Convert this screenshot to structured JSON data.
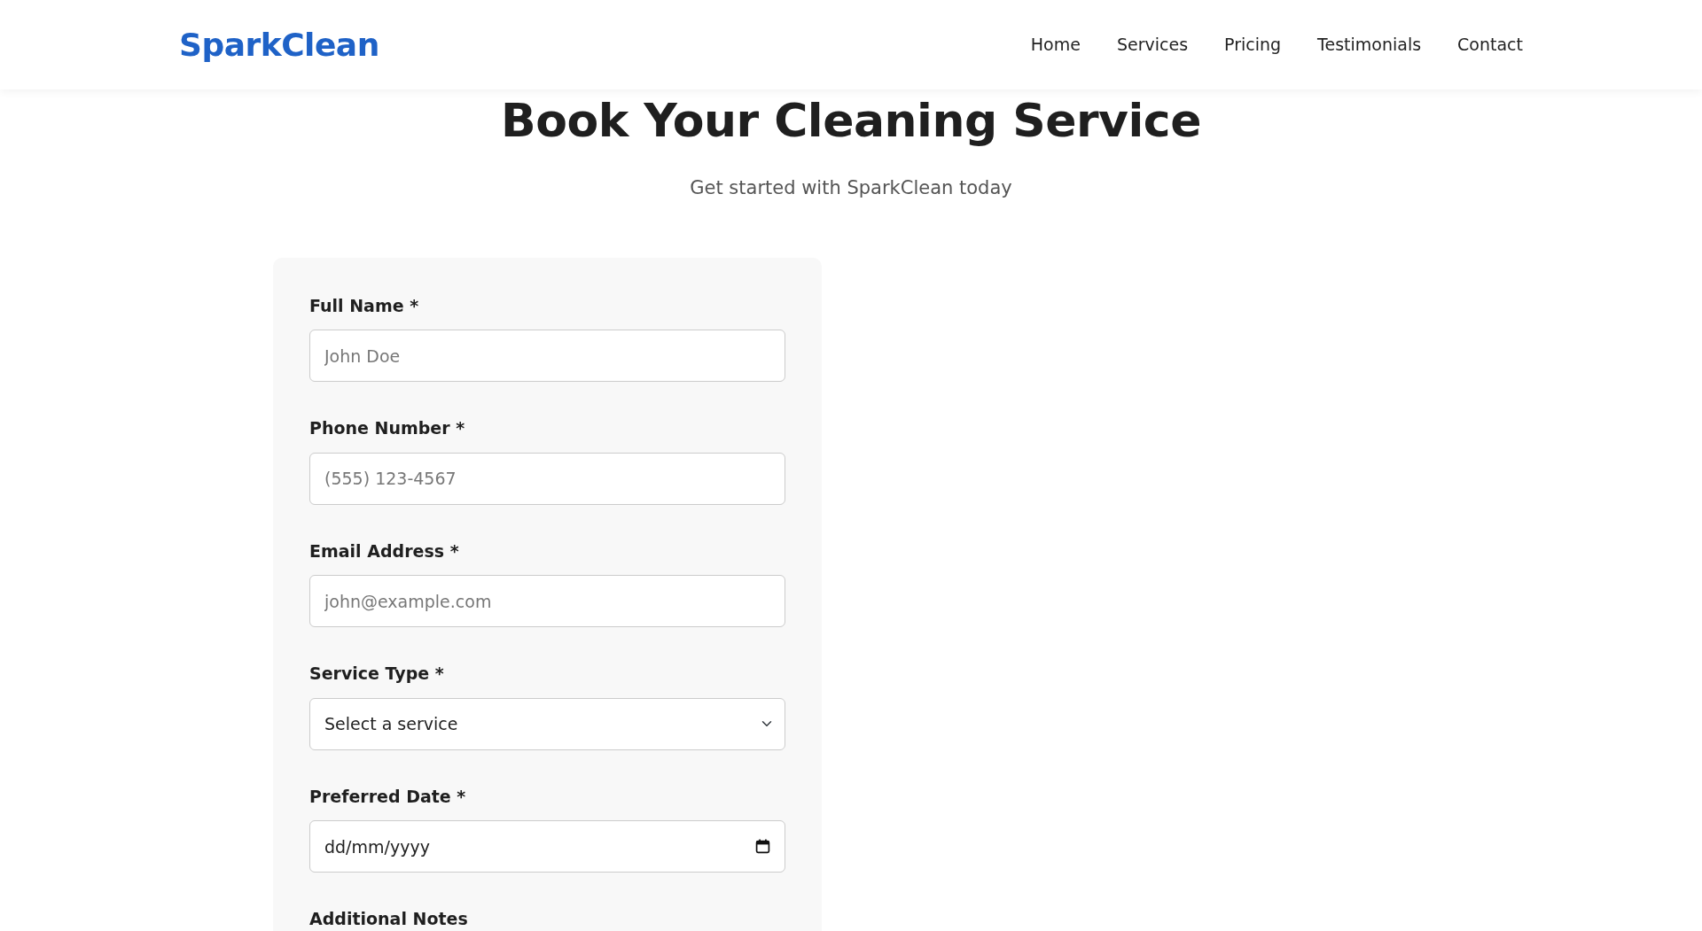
{
  "brand": "SparkClean",
  "nav": [
    {
      "label": "Home"
    },
    {
      "label": "Services"
    },
    {
      "label": "Pricing"
    },
    {
      "label": "Testimonials"
    },
    {
      "label": "Contact"
    }
  ],
  "heading": "Book Your Cleaning Service",
  "subtitle": "Get started with SparkClean today",
  "fields": [
    {
      "label": "Full Name *",
      "control": {
        "kind": "text",
        "placeholder": "John Doe"
      }
    },
    {
      "label": "Phone Number *",
      "control": {
        "kind": "text",
        "placeholder": "(555) 123-4567"
      }
    },
    {
      "label": "Email Address *",
      "control": {
        "kind": "text",
        "placeholder": "john@example.com"
      }
    },
    {
      "label": "Service Type *",
      "control": {
        "kind": "select",
        "value": "Select a service"
      }
    },
    {
      "label": "Preferred Date *",
      "control": {
        "kind": "date",
        "value": "dd/mm/yyyy"
      }
    },
    {
      "label": "Additional Notes"
    }
  ]
}
